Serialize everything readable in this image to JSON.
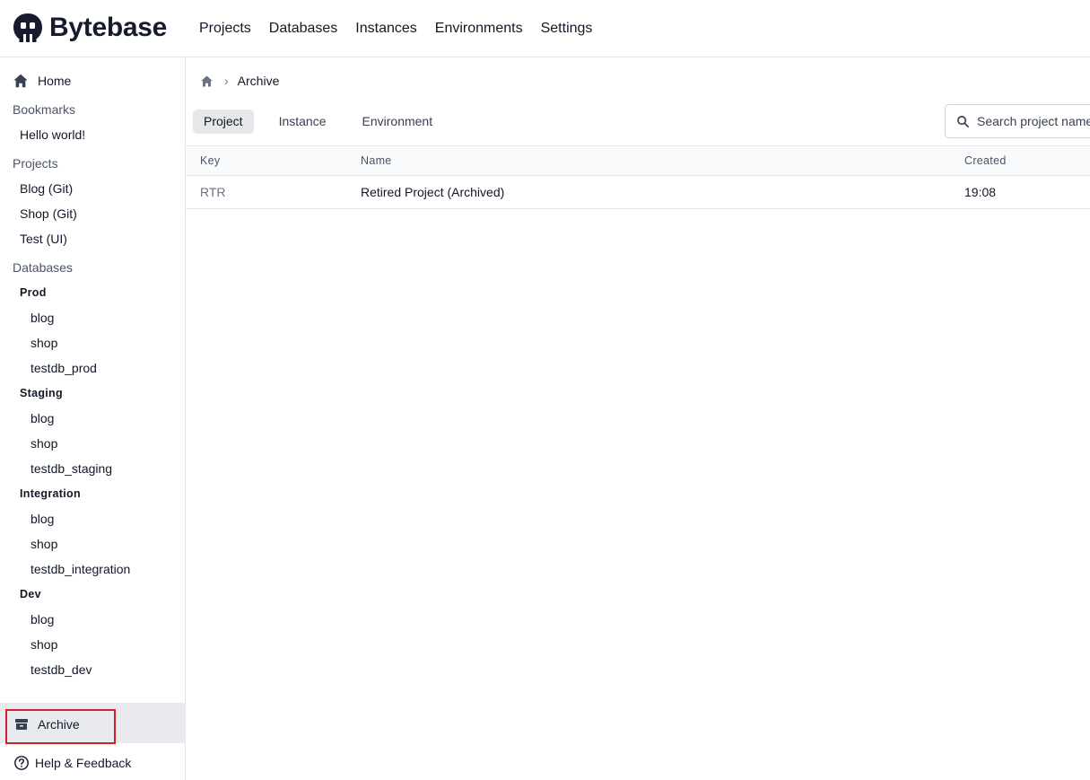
{
  "app": {
    "brand": "Bytebase"
  },
  "topnav": {
    "items": [
      "Projects",
      "Databases",
      "Instances",
      "Environments",
      "Settings"
    ]
  },
  "sidebar": {
    "home": "Home",
    "bookmarks_label": "Bookmarks",
    "bookmarks": [
      "Hello world!"
    ],
    "projects_label": "Projects",
    "projects": [
      "Blog (Git)",
      "Shop (Git)",
      "Test (UI)"
    ],
    "databases_label": "Databases",
    "environments": [
      {
        "name": "Prod",
        "databases": [
          "blog",
          "shop",
          "testdb_prod"
        ]
      },
      {
        "name": "Staging",
        "databases": [
          "blog",
          "shop",
          "testdb_staging"
        ]
      },
      {
        "name": "Integration",
        "databases": [
          "blog",
          "shop",
          "testdb_integration"
        ]
      },
      {
        "name": "Dev",
        "databases": [
          "blog",
          "shop",
          "testdb_dev"
        ]
      }
    ],
    "archive": "Archive",
    "help": "Help & Feedback"
  },
  "breadcrumb": {
    "current": "Archive"
  },
  "tabs": {
    "items": [
      "Project",
      "Instance",
      "Environment"
    ],
    "active": "Project"
  },
  "search": {
    "placeholder": "Search project name"
  },
  "table": {
    "headers": {
      "key": "Key",
      "name": "Name",
      "created": "Created"
    },
    "rows": [
      {
        "key": "RTR",
        "name": "Retired Project (Archived)",
        "created": "19:08"
      }
    ]
  },
  "colors": {
    "highlight": "#d21f2d",
    "brand": "#161c2e"
  }
}
